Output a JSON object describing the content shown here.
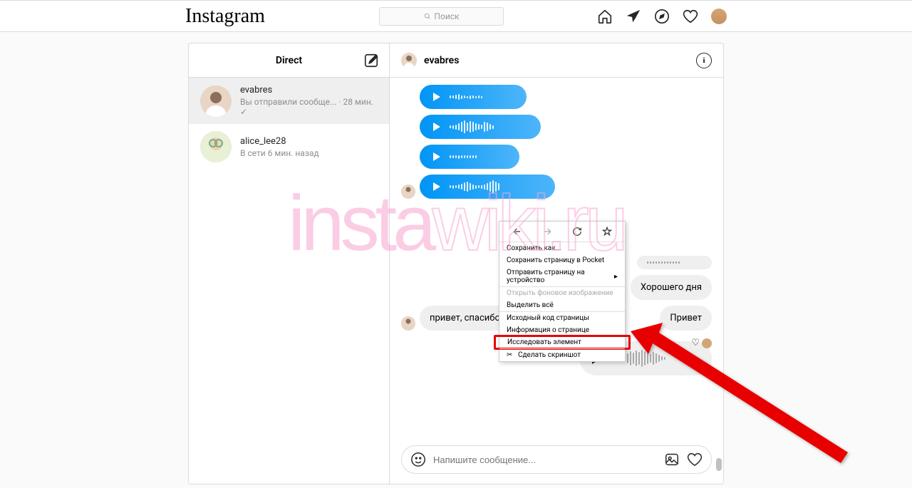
{
  "header": {
    "logo": "Instagram",
    "search_placeholder": "Поиск"
  },
  "sidebar": {
    "title": "Direct",
    "conversations": [
      {
        "name": "evabres",
        "status": "Вы отправили сообще... · 28 мин. ✓",
        "selected": true
      },
      {
        "name": "alice_lee28",
        "status": "В сети 6 мин. назад",
        "selected": false
      }
    ]
  },
  "chat": {
    "contact_name": "evabres",
    "outgoing_text": [
      "Хорошего дня",
      "Привет"
    ],
    "incoming_text": "привет, спасибо",
    "composer_placeholder": "Напишите сообщение..."
  },
  "context_menu": {
    "items": [
      {
        "label": "Сохранить как...",
        "enabled": true
      },
      {
        "label": "Сохранить страницу в Pocket",
        "enabled": true
      },
      {
        "label": "Отправить страницу на устройство",
        "enabled": true,
        "submenu": true
      },
      {
        "label": "Открыть фоновое изображение",
        "enabled": false,
        "sep": true
      },
      {
        "label": "Выделить всё",
        "enabled": true
      },
      {
        "label": "Исходный код страницы",
        "enabled": true,
        "sep": true
      },
      {
        "label": "Информация о странице",
        "enabled": true
      },
      {
        "label": "Исследовать элемент",
        "enabled": true,
        "highlight": true
      },
      {
        "label": "Сделать скриншот",
        "enabled": true,
        "sep": true,
        "icon": "✂"
      }
    ]
  },
  "watermark": "instawiki.ru"
}
